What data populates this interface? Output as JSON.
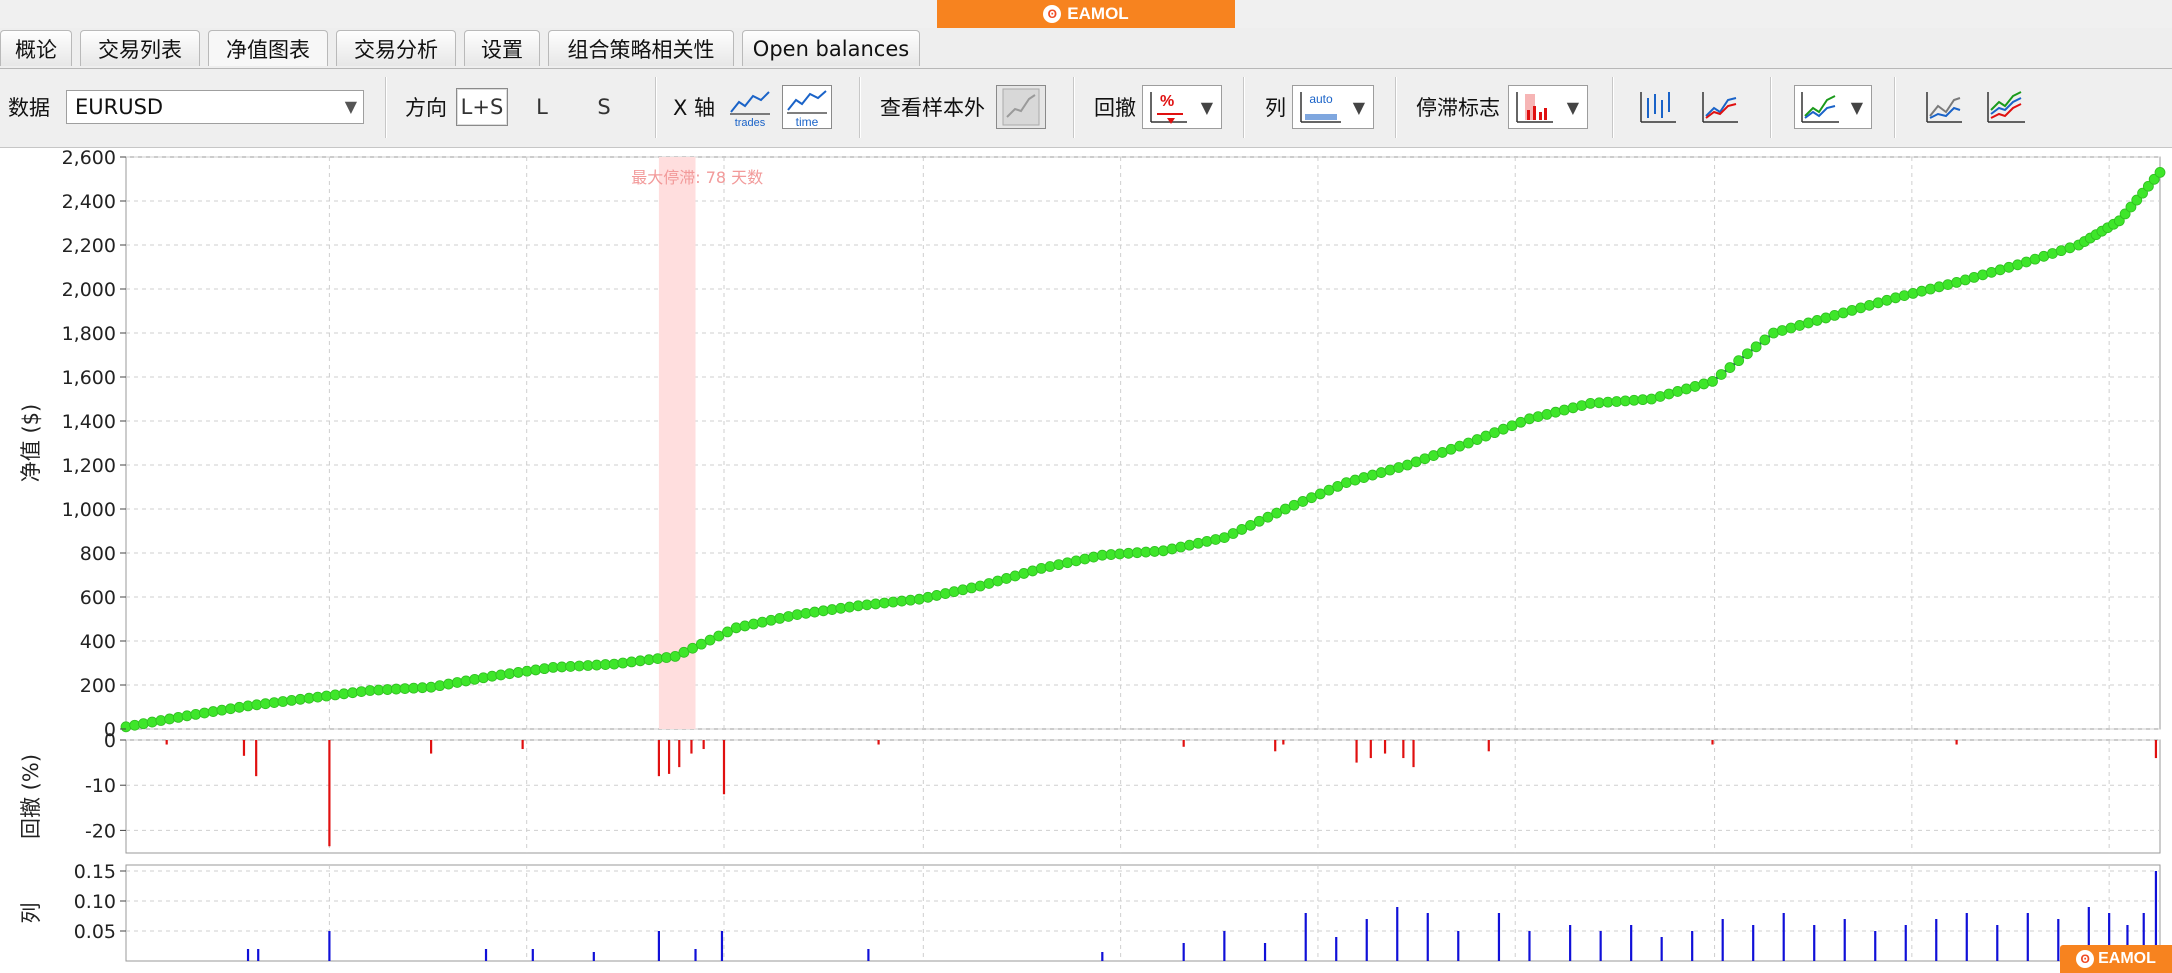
{
  "brand": {
    "name": "EAMOL",
    "logo_icon": "eamol-logo-icon",
    "color": "#f7831f"
  },
  "tabs": [
    {
      "label": "概论"
    },
    {
      "label": "交易列表"
    },
    {
      "label": "净值图表",
      "active": true
    },
    {
      "label": "交易分析"
    },
    {
      "label": "设置"
    },
    {
      "label": "组合策略相关性"
    },
    {
      "label": "Open balances"
    }
  ],
  "toolbar": {
    "data_label": "数据",
    "data_value": "EURUSD",
    "direction_label": "方向",
    "direction_options": [
      "L+S",
      "L",
      "S"
    ],
    "direction_selected": "L+S",
    "x_axis_label": "X 轴",
    "x_axis_options": [
      "trades",
      "time"
    ],
    "x_axis_selected": "time",
    "oos_label": "查看样本外",
    "drawdown_label": "回撤",
    "column_label": "列",
    "column_auto": "auto",
    "stagnation_label": "停滞标志"
  },
  "chart_data": {
    "type": "line",
    "equity": {
      "ylabel": "净值 ($)",
      "ylim": [
        0,
        2600
      ],
      "yticks": [
        "0",
        "200",
        "400",
        "600",
        "800",
        "1,000",
        "1,200",
        "1,400",
        "1,600",
        "1,800",
        "2,000",
        "2,200",
        "2,400",
        "2,600"
      ],
      "ytick_values": [
        0,
        200,
        400,
        600,
        800,
        1000,
        1200,
        1400,
        1600,
        1800,
        2000,
        2200,
        2400,
        2600
      ],
      "x_range": [
        0,
        100
      ],
      "series": [
        {
          "line_color": "#1a1aa0",
          "marker_color": "#3ee62a",
          "x": [
            0,
            3,
            6,
            9,
            12,
            15,
            18,
            21,
            24,
            27,
            30,
            33,
            36,
            39,
            42,
            45,
            48,
            51,
            54,
            57,
            60,
            63,
            66,
            69,
            72,
            75,
            78,
            81,
            84,
            87,
            90,
            93,
            96,
            98,
            100
          ],
          "y": [
            10,
            60,
            105,
            140,
            175,
            190,
            240,
            280,
            295,
            330,
            460,
            520,
            560,
            590,
            650,
            730,
            790,
            810,
            870,
            1000,
            1120,
            1200,
            1300,
            1410,
            1480,
            1500,
            1580,
            1800,
            1880,
            1960,
            2030,
            2110,
            2200,
            2310,
            2530
          ]
        }
      ],
      "stagnation_label": "最大停滞: 78 天数",
      "stagnation_x": [
        26.2,
        28.0
      ],
      "stagnation_color": "#ffdede"
    },
    "drawdown": {
      "ylabel": "回撤 (%)",
      "ylim": [
        -25,
        0
      ],
      "yticks": [
        "0",
        "-10",
        "-20"
      ],
      "ytick_values": [
        0,
        -10,
        -20
      ],
      "color": "#e01010",
      "bars": [
        {
          "x": 2,
          "v": -1
        },
        {
          "x": 5.8,
          "v": -3.5
        },
        {
          "x": 6.4,
          "v": -8
        },
        {
          "x": 10,
          "v": -23.5
        },
        {
          "x": 15,
          "v": -3
        },
        {
          "x": 19.5,
          "v": -2
        },
        {
          "x": 26.2,
          "v": -8
        },
        {
          "x": 26.7,
          "v": -7.5
        },
        {
          "x": 27.2,
          "v": -6
        },
        {
          "x": 27.8,
          "v": -3
        },
        {
          "x": 28.4,
          "v": -2
        },
        {
          "x": 29.4,
          "v": -12
        },
        {
          "x": 37,
          "v": -1
        },
        {
          "x": 52,
          "v": -1.5
        },
        {
          "x": 56.5,
          "v": -2.5
        },
        {
          "x": 56.9,
          "v": -1
        },
        {
          "x": 60.5,
          "v": -5
        },
        {
          "x": 61.2,
          "v": -4
        },
        {
          "x": 61.9,
          "v": -3
        },
        {
          "x": 62.8,
          "v": -4
        },
        {
          "x": 63.3,
          "v": -6
        },
        {
          "x": 67,
          "v": -2.5
        },
        {
          "x": 78,
          "v": -1
        },
        {
          "x": 90,
          "v": -1
        },
        {
          "x": 99.8,
          "v": -4
        }
      ]
    },
    "columns": {
      "ylabel": "列",
      "ylim": [
        0,
        0.16
      ],
      "yticks": [
        "0.05",
        "0.10",
        "0.15"
      ],
      "ytick_values": [
        0.05,
        0.1,
        0.15
      ],
      "color": "#1010d8",
      "bars": [
        {
          "x": 6,
          "v": 0.02
        },
        {
          "x": 6.5,
          "v": 0.02
        },
        {
          "x": 10,
          "v": 0.05
        },
        {
          "x": 17.7,
          "v": 0.02
        },
        {
          "x": 20,
          "v": 0.02
        },
        {
          "x": 23,
          "v": 0.015
        },
        {
          "x": 26.2,
          "v": 0.05
        },
        {
          "x": 28,
          "v": 0.02
        },
        {
          "x": 29.3,
          "v": 0.05
        },
        {
          "x": 36.5,
          "v": 0.02
        },
        {
          "x": 48,
          "v": 0.015
        },
        {
          "x": 52,
          "v": 0.03
        },
        {
          "x": 54,
          "v": 0.05
        },
        {
          "x": 56,
          "v": 0.03
        },
        {
          "x": 58,
          "v": 0.08
        },
        {
          "x": 59.5,
          "v": 0.04
        },
        {
          "x": 61,
          "v": 0.07
        },
        {
          "x": 62.5,
          "v": 0.09
        },
        {
          "x": 64,
          "v": 0.08
        },
        {
          "x": 65.5,
          "v": 0.05
        },
        {
          "x": 67.5,
          "v": 0.08
        },
        {
          "x": 69,
          "v": 0.05
        },
        {
          "x": 71,
          "v": 0.06
        },
        {
          "x": 72.5,
          "v": 0.05
        },
        {
          "x": 74,
          "v": 0.06
        },
        {
          "x": 75.5,
          "v": 0.04
        },
        {
          "x": 77,
          "v": 0.05
        },
        {
          "x": 78.5,
          "v": 0.07
        },
        {
          "x": 80,
          "v": 0.06
        },
        {
          "x": 81.5,
          "v": 0.08
        },
        {
          "x": 83,
          "v": 0.06
        },
        {
          "x": 84.5,
          "v": 0.07
        },
        {
          "x": 86,
          "v": 0.05
        },
        {
          "x": 87.5,
          "v": 0.06
        },
        {
          "x": 89,
          "v": 0.07
        },
        {
          "x": 90.5,
          "v": 0.08
        },
        {
          "x": 92,
          "v": 0.06
        },
        {
          "x": 93.5,
          "v": 0.08
        },
        {
          "x": 95,
          "v": 0.07
        },
        {
          "x": 96.5,
          "v": 0.09
        },
        {
          "x": 97.5,
          "v": 0.08
        },
        {
          "x": 98.4,
          "v": 0.06
        },
        {
          "x": 99.2,
          "v": 0.08
        },
        {
          "x": 99.8,
          "v": 0.15
        }
      ]
    },
    "grid": true,
    "vertical_gridlines": [
      10,
      19.7,
      29.4,
      39.2,
      48.9,
      58.6,
      68.3,
      78.1,
      87.8,
      97.5
    ]
  }
}
